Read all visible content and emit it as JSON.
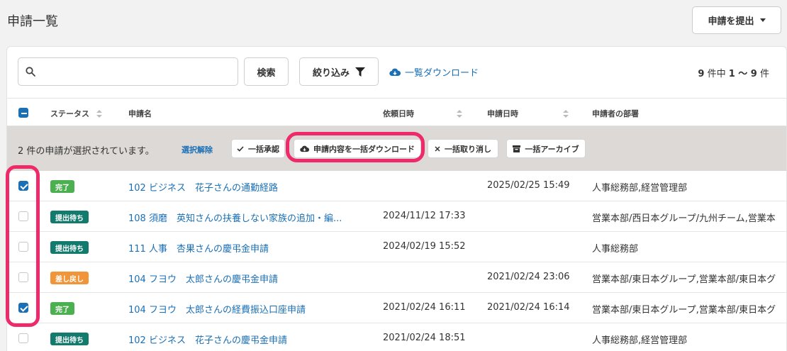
{
  "header": {
    "title": "申請一覧",
    "submit_label": "申請を提出"
  },
  "toolbar": {
    "search_placeholder": "",
    "search_label": "検索",
    "filter_label": "絞り込み",
    "download_label": "一覧ダウンロード",
    "count_prefix": "9",
    "count_mid": " 件中 ",
    "count_range": "1 〜 9",
    "count_suffix": " 件"
  },
  "columns": {
    "status": "ステータス",
    "name": "申請名",
    "requested_at": "依頼日時",
    "applied_at": "申請日時",
    "department": "申請者の部署"
  },
  "selection_bar": {
    "text": "2 件の申請が選択されています。",
    "clear_label": "選択解除",
    "approve_label": "一括承認",
    "download_label": "申請内容を一括ダウンロード",
    "cancel_label": "一括取り消し",
    "archive_label": "一括アーカイブ"
  },
  "colors": {
    "accent": "#1a6fb5",
    "done": "#4caf50",
    "waiting": "#137a6e",
    "returned": "#f0953a",
    "highlight": "#ee2a6a"
  },
  "rows": [
    {
      "checked": true,
      "status": "完了",
      "status_type": "done",
      "name": "102 ビジネス　花子さんの通勤経路",
      "requested_at": "",
      "applied_at": "2025/02/25 15:49",
      "department": "人事総務部,経営管理部"
    },
    {
      "checked": false,
      "status": "提出待ち",
      "status_type": "waiting",
      "name": "108 須磨　英知さんの扶養しない家族の追加・編...",
      "requested_at": "2024/11/12 17:33",
      "applied_at": "",
      "department": "営業本部/西日本グループ/九州チーム,営業本"
    },
    {
      "checked": false,
      "status": "提出待ち",
      "status_type": "waiting",
      "name": "111 人事　杏果さんの慶弔金申請",
      "requested_at": "2024/02/19 15:52",
      "applied_at": "",
      "department": "人事総務部"
    },
    {
      "checked": false,
      "status": "差し戻し",
      "status_type": "returned",
      "name": "104 フヨウ　太郎さんの慶弔金申請",
      "requested_at": "",
      "applied_at": "2021/02/24 23:06",
      "department": "営業本部/東日本グループ,営業本部/東日本グ"
    },
    {
      "checked": true,
      "status": "完了",
      "status_type": "done",
      "name": "104 フヨウ　太郎さんの経費振込口座申請",
      "requested_at": "2021/02/24 16:11",
      "applied_at": "2021/02/24 16:14",
      "department": "営業本部/東日本グループ,営業本部/東日本グ"
    },
    {
      "checked": false,
      "status": "提出待ち",
      "status_type": "waiting",
      "name": "102 ビジネス　花子さんの慶弔金申請",
      "requested_at": "2021/02/24 18:51",
      "applied_at": "",
      "department": "人事総務部,経営管理部"
    }
  ]
}
